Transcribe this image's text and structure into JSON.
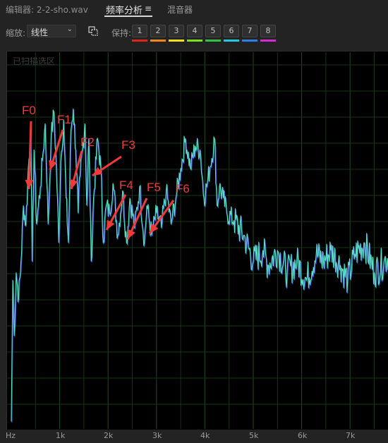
{
  "tabs": {
    "editor": "编辑器: 2-2-sho.wav",
    "frequency": "频率分析",
    "frequency_menu": "≡",
    "mixer": "混音器"
  },
  "toolbar": {
    "scale_label": "缩放:",
    "scale_value": "线性",
    "hold_label": "保持:",
    "hold_buttons": [
      "1",
      "2",
      "3",
      "4",
      "5",
      "6",
      "7",
      "8"
    ],
    "hold_colors": [
      "#e0251d",
      "#f0891a",
      "#ece31d",
      "#79e01e",
      "#33c34a",
      "#25c8e6",
      "#2f7fe6",
      "#d52ad8"
    ]
  },
  "panel": {
    "scanned_label": "已扫描选区"
  },
  "chart_data": {
    "type": "line",
    "x_axis_unit": "Hz",
    "x_ticks": [
      "Hz",
      "1k",
      "2k",
      "3k",
      "4k",
      "5k",
      "6k",
      "7k"
    ],
    "xlim": [
      0,
      8000
    ],
    "grid": true,
    "line_color": "#5ee0c0",
    "series": [
      {
        "x": [
          0,
          30,
          60,
          100,
          150,
          200,
          250,
          300,
          350,
          400,
          430,
          470,
          520,
          560,
          600,
          640,
          700,
          760,
          820,
          880,
          930,
          980,
          1020,
          1080,
          1130,
          1180,
          1230,
          1280,
          1330,
          1380,
          1420,
          1470,
          1520,
          1560,
          1600,
          1650,
          1700,
          1780,
          1850,
          1900,
          1960,
          2030,
          2100,
          2200,
          2300,
          2380,
          2450,
          2550,
          2650,
          2750,
          2800,
          2900,
          3000,
          3100,
          3200,
          3300,
          3400,
          3500,
          3600,
          3700,
          3800,
          3900,
          3980,
          4050,
          4100,
          4200,
          4250,
          4300,
          4380,
          4450,
          4600,
          4800,
          5000,
          5200,
          5300,
          5500,
          5700,
          5900,
          6100,
          6300,
          6450,
          6600,
          6800,
          6950,
          7100,
          7300,
          7500,
          7700,
          7900,
          8000
        ],
        "y": [
          2,
          40,
          25,
          42,
          35,
          45,
          60,
          55,
          70,
          80,
          45,
          75,
          55,
          60,
          65,
          72,
          82,
          55,
          78,
          85,
          70,
          50,
          72,
          83,
          62,
          50,
          80,
          86,
          75,
          58,
          68,
          75,
          82,
          60,
          78,
          45,
          62,
          78,
          70,
          50,
          60,
          58,
          66,
          52,
          64,
          50,
          62,
          54,
          65,
          50,
          60,
          52,
          58,
          54,
          64,
          55,
          62,
          70,
          78,
          70,
          76,
          75,
          62,
          66,
          70,
          78,
          60,
          65,
          62,
          58,
          56,
          52,
          45,
          48,
          44,
          48,
          42,
          45,
          40,
          47,
          45,
          48,
          44,
          40,
          47,
          50,
          42,
          45,
          48,
          42
        ]
      }
    ]
  }
}
